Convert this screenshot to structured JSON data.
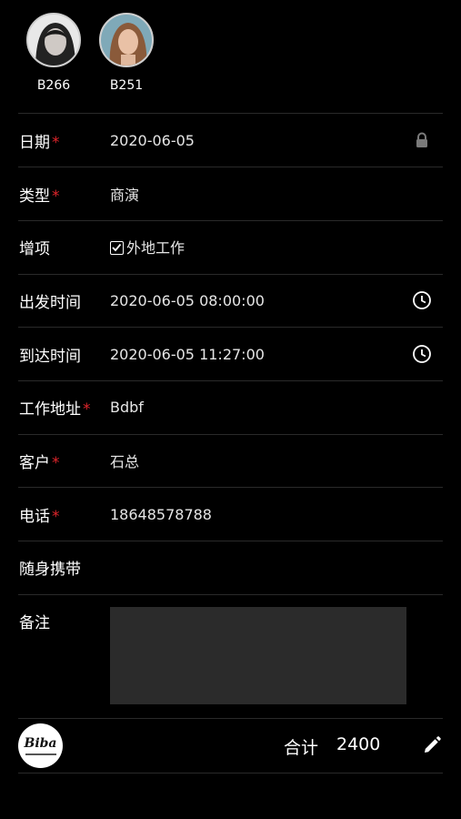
{
  "models": [
    {
      "code": "B266"
    },
    {
      "code": "B251"
    }
  ],
  "form": {
    "date": {
      "label": "日期",
      "value": "2020-06-05"
    },
    "type": {
      "label": "类型",
      "value": "商演"
    },
    "extra": {
      "label": "增项",
      "option": "外地工作",
      "checked": true
    },
    "depart": {
      "label": "出发时间",
      "value": "2020-06-05 08:00:00"
    },
    "arrive": {
      "label": "到达时间",
      "value": "2020-06-05 11:27:00"
    },
    "address": {
      "label": "工作地址",
      "value": "Bdbf"
    },
    "client": {
      "label": "客户",
      "value": "石总"
    },
    "phone": {
      "label": "电话",
      "value": "18648578788"
    },
    "carry": {
      "label": "随身携带",
      "value": ""
    },
    "notes": {
      "label": "备注",
      "value": ""
    }
  },
  "required_mark": "*",
  "footer": {
    "logo_text": "Biba",
    "total_label": "合计",
    "total_value": "2400"
  },
  "colors": {
    "background": "#000000",
    "required": "#e0252b",
    "divider": "#2a2a2a",
    "notes_box": "#2b2b2b"
  },
  "icons": {
    "date": "lock-icon",
    "depart": "clock-icon",
    "arrive": "clock-icon",
    "footer": "edit-pencil-icon"
  }
}
